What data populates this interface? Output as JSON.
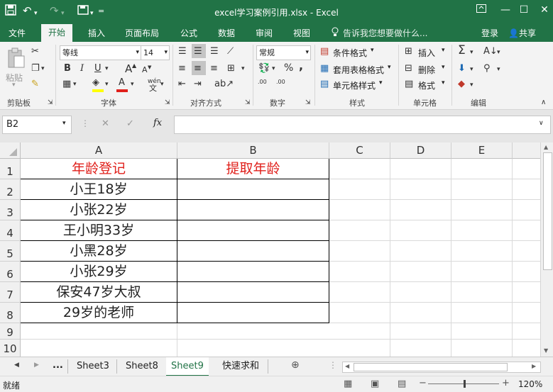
{
  "window": {
    "title": "excel学习案例引用.xlsx - Excel",
    "qat": {
      "save_icon": "save-icon",
      "undo_icon": "undo-icon",
      "redo_icon": "redo-icon",
      "touch_icon": "touch-mode-icon",
      "customize_icon": "chevron-down-icon"
    },
    "controls": {
      "ribbon_options": "ribbon-display-icon",
      "minimize": "—",
      "restore": "☐",
      "close": "✕"
    }
  },
  "tabs": [
    "文件",
    "开始",
    "插入",
    "页面布局",
    "公式",
    "数据",
    "审阅",
    "视图"
  ],
  "active_tab": "开始",
  "tell_me": "告诉我您想要做什么...",
  "login": "登录",
  "share": "共享",
  "ribbon": {
    "clipboard": {
      "paste": "粘贴",
      "group": "剪贴板"
    },
    "font": {
      "name": "等线",
      "size": "14",
      "bold": "B",
      "italic": "I",
      "underline": "U",
      "grow": "A",
      "shrink": "A",
      "font_color_letter": "A",
      "phonetic": "wén",
      "group": "字体"
    },
    "alignment": {
      "group": "对齐方式"
    },
    "number": {
      "format": "常规",
      "percent": "%",
      "comma": ",",
      "inc_dec": ".00",
      "dec_dec": ".00",
      "group": "数字"
    },
    "styles": {
      "conditional": "条件格式",
      "table": "套用表格格式",
      "cell": "单元格样式",
      "group": "样式"
    },
    "cells": {
      "insert": "插入",
      "delete": "删除",
      "format": "格式",
      "group": "单元格"
    },
    "editing": {
      "group": "编辑"
    }
  },
  "formula_bar": {
    "name_box": "B2",
    "cancel": "✕",
    "enter": "✓",
    "fx": "fx",
    "value": ""
  },
  "columns": [
    "A",
    "B",
    "C",
    "D",
    "E"
  ],
  "rows": [
    "1",
    "2",
    "3",
    "4",
    "5",
    "6",
    "7",
    "8",
    "9",
    "10"
  ],
  "cells": {
    "A1": "年龄登记",
    "B1": "提取年龄",
    "A2": "小王18岁",
    "A3": "小张22岁",
    "A4": "王小明33岁",
    "A5": "小黑28岁",
    "A6": "小张29岁",
    "A7": "保安47岁大叔",
    "A8": "29岁的老师"
  },
  "header_color": "#e0201b",
  "sheet_tabs": [
    "Sheet3",
    "Sheet8",
    "Sheet9",
    "快速求和"
  ],
  "active_sheet": "Sheet9",
  "ellipsis": "...",
  "status": {
    "ready": "就绪",
    "zoom": "120%",
    "minus": "−",
    "plus": "+"
  },
  "colors": {
    "accent": "#217346"
  }
}
